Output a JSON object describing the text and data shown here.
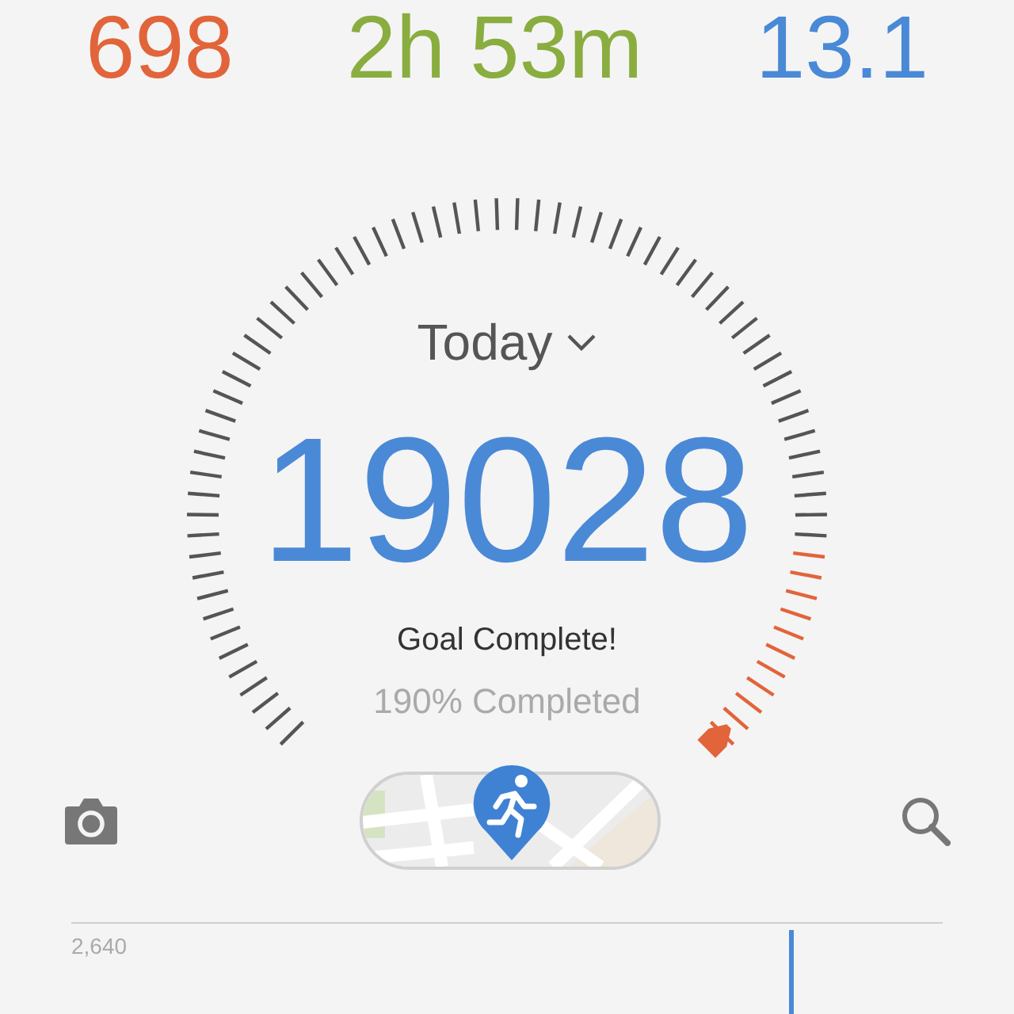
{
  "stats": [
    {
      "value": "698",
      "color": "#e2643a"
    },
    {
      "value": "2h 53m",
      "color": "#8aad3f"
    },
    {
      "value": "13.1",
      "color": "#4a89d6"
    }
  ],
  "gauge": {
    "period": "Today",
    "steps": "19028",
    "status": "Goal Complete!",
    "percent": "190% Completed"
  },
  "chart": {
    "max_label": "2,640"
  }
}
